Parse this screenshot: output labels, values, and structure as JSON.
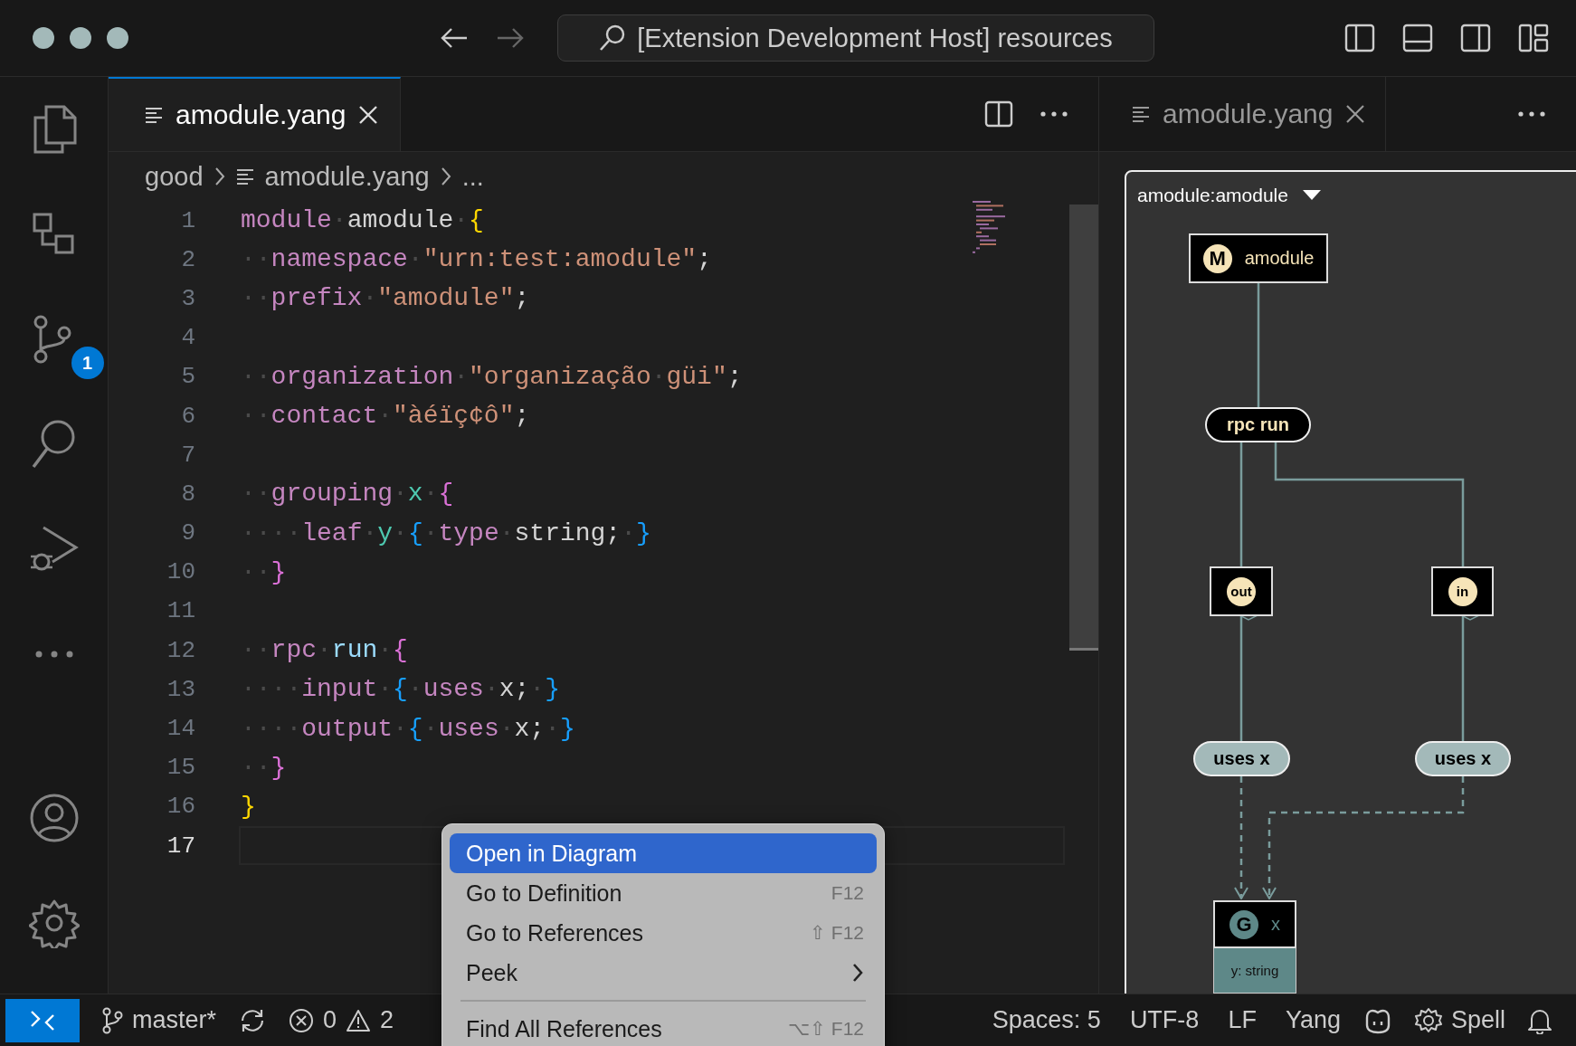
{
  "window": {
    "command_center": "[Extension Development Host] resources"
  },
  "activity_bar": [
    {
      "kind": "files"
    },
    {
      "kind": "remote"
    },
    {
      "kind": "scm",
      "badge": "1"
    },
    {
      "kind": "search"
    },
    {
      "kind": "debug"
    },
    {
      "kind": "more"
    },
    {
      "kind": "account"
    },
    {
      "kind": "settings"
    }
  ],
  "editor": {
    "tab": {
      "label": "amodule.yang",
      "selected": true
    },
    "breadcrumb": [
      "good",
      "amodule.yang",
      "..."
    ],
    "lines": [
      {
        "number": "1",
        "current": false,
        "tokens": [
          {
            "kind": "kw",
            "text": "module"
          },
          {
            "kind": "ws",
            "text": "·"
          },
          {
            "kind": "id",
            "text": "amodule"
          },
          {
            "kind": "ws",
            "text": "·"
          },
          {
            "kind": "b1",
            "text": "{"
          }
        ]
      },
      {
        "number": "2",
        "current": false,
        "tokens": [
          {
            "kind": "ws",
            "text": "··"
          },
          {
            "kind": "kw",
            "text": "namespace"
          },
          {
            "kind": "ws",
            "text": "·"
          },
          {
            "kind": "str",
            "text": "\"urn:test:amodule\""
          },
          {
            "kind": "id",
            "text": ";"
          }
        ]
      },
      {
        "number": "3",
        "current": false,
        "tokens": [
          {
            "kind": "ws",
            "text": "··"
          },
          {
            "kind": "kw",
            "text": "prefix"
          },
          {
            "kind": "ws",
            "text": "·"
          },
          {
            "kind": "str",
            "text": "\"amodule\""
          },
          {
            "kind": "id",
            "text": ";"
          }
        ]
      },
      {
        "number": "4",
        "current": false
      },
      {
        "number": "5",
        "current": false,
        "tokens": [
          {
            "kind": "ws",
            "text": "··"
          },
          {
            "kind": "kw",
            "text": "organization"
          },
          {
            "kind": "ws",
            "text": "·"
          },
          {
            "kind": "str",
            "text": "\"organização"
          },
          {
            "kind": "ws",
            "text": "·"
          },
          {
            "kind": "str",
            "text": "güi\""
          },
          {
            "kind": "id",
            "text": ";"
          }
        ]
      },
      {
        "number": "6",
        "current": false,
        "tokens": [
          {
            "kind": "ws",
            "text": "··"
          },
          {
            "kind": "kw",
            "text": "contact"
          },
          {
            "kind": "ws",
            "text": "·"
          },
          {
            "kind": "str",
            "text": "\"àéïç¢ô\""
          },
          {
            "kind": "id",
            "text": ";"
          }
        ]
      },
      {
        "number": "7",
        "current": false
      },
      {
        "number": "8",
        "current": false,
        "tokens": [
          {
            "kind": "ws",
            "text": "··"
          },
          {
            "kind": "kw",
            "text": "grouping"
          },
          {
            "kind": "ws",
            "text": "·"
          },
          {
            "kind": "type",
            "text": "x"
          },
          {
            "kind": "ws",
            "text": "·"
          },
          {
            "kind": "b2",
            "text": "{"
          }
        ]
      },
      {
        "number": "9",
        "current": false,
        "tokens": [
          {
            "kind": "ws",
            "text": "····"
          },
          {
            "kind": "kw",
            "text": "leaf"
          },
          {
            "kind": "ws",
            "text": "·"
          },
          {
            "kind": "type",
            "text": "y"
          },
          {
            "kind": "ws",
            "text": "·"
          },
          {
            "kind": "b3",
            "text": "{"
          },
          {
            "kind": "ws",
            "text": "·"
          },
          {
            "kind": "kw",
            "text": "type"
          },
          {
            "kind": "ws",
            "text": "·"
          },
          {
            "kind": "id",
            "text": "string;"
          },
          {
            "kind": "ws",
            "text": "·"
          },
          {
            "kind": "b3",
            "text": "}"
          }
        ]
      },
      {
        "number": "10",
        "current": false,
        "tokens": [
          {
            "kind": "ws",
            "text": "··"
          },
          {
            "kind": "b2",
            "text": "}"
          }
        ]
      },
      {
        "number": "11",
        "current": false
      },
      {
        "number": "12",
        "current": false,
        "tokens": [
          {
            "kind": "ws",
            "text": "··"
          },
          {
            "kind": "kw",
            "text": "rpc"
          },
          {
            "kind": "ws",
            "text": "·"
          },
          {
            "kind": "fn",
            "text": "run"
          },
          {
            "kind": "ws",
            "text": "·"
          },
          {
            "kind": "b2",
            "text": "{"
          }
        ]
      },
      {
        "number": "13",
        "current": false,
        "tokens": [
          {
            "kind": "ws",
            "text": "····"
          },
          {
            "kind": "kw",
            "text": "input"
          },
          {
            "kind": "ws",
            "text": "·"
          },
          {
            "kind": "b3",
            "text": "{"
          },
          {
            "kind": "ws",
            "text": "·"
          },
          {
            "kind": "kw",
            "text": "uses"
          },
          {
            "kind": "ws",
            "text": "·"
          },
          {
            "kind": "id",
            "text": "x;"
          },
          {
            "kind": "ws",
            "text": "·"
          },
          {
            "kind": "b3",
            "text": "}"
          }
        ]
      },
      {
        "number": "14",
        "current": false,
        "tokens": [
          {
            "kind": "ws",
            "text": "····"
          },
          {
            "kind": "kw",
            "text": "output"
          },
          {
            "kind": "ws",
            "text": "·"
          },
          {
            "kind": "b3",
            "text": "{"
          },
          {
            "kind": "ws",
            "text": "·"
          },
          {
            "kind": "kw",
            "text": "uses"
          },
          {
            "kind": "ws",
            "text": "·"
          },
          {
            "kind": "id",
            "text": "x;"
          },
          {
            "kind": "ws",
            "text": "·"
          },
          {
            "kind": "b3",
            "text": "}"
          }
        ]
      },
      {
        "number": "15",
        "current": false,
        "tokens": [
          {
            "kind": "ws",
            "text": "··"
          },
          {
            "kind": "b2",
            "text": "}"
          }
        ]
      },
      {
        "number": "16",
        "current": false,
        "tokens": [
          {
            "kind": "b1",
            "text": "}"
          }
        ]
      },
      {
        "number": "17",
        "current": true
      }
    ]
  },
  "preview": {
    "tab": {
      "label": "amodule.yang",
      "selected": false
    },
    "selector": "amodule:amodule",
    "nodes": [
      {
        "kind": "module",
        "badge": "M",
        "label": "amodule"
      },
      {
        "kind": "rpc",
        "label": "rpc run"
      },
      {
        "kind": "output",
        "badge": "out"
      },
      {
        "kind": "input",
        "badge": "in"
      },
      {
        "kind": "uses",
        "label": "uses x"
      },
      {
        "kind": "uses",
        "label": "uses x"
      },
      {
        "kind": "grouping",
        "badge": "G",
        "label": "x",
        "attribute": "y: string"
      }
    ]
  },
  "context_menu": [
    {
      "kind": "item",
      "label": "Open in Diagram",
      "selected": true
    },
    {
      "kind": "item",
      "label": "Go to Definition",
      "shortcut": "F12",
      "selected": false
    },
    {
      "kind": "item",
      "label": "Go to References",
      "shortcut": "⇧ F12",
      "selected": false
    },
    {
      "kind": "item",
      "label": "Peek",
      "submenu": true,
      "selected": false
    },
    {
      "kind": "separator"
    },
    {
      "kind": "item",
      "label": "Find All References",
      "shortcut": "⌥⇧ F12",
      "selected": false
    }
  ],
  "status_bar": {
    "branch": "master*",
    "errors": "0",
    "warnings": "2",
    "right": [
      "Spaces: 5",
      "UTF-8",
      "LF",
      "Yang"
    ],
    "spell": "Spell"
  }
}
